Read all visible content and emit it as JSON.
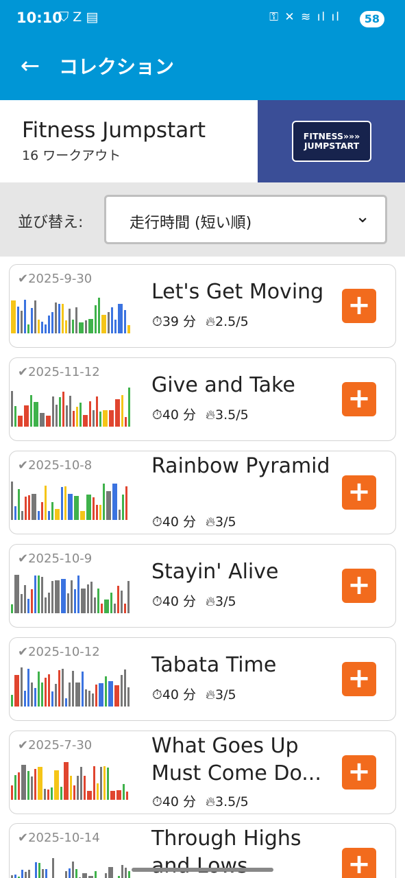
{
  "status": {
    "time": "10:10",
    "battery": "58"
  },
  "appbar": {
    "title": "コレクション"
  },
  "collection": {
    "title": "Fitness Jumpstart",
    "subtitle": "16 ワークアウト",
    "logo_line1": "FITNESS»»»",
    "logo_line2": "JUMPSTART"
  },
  "sort": {
    "label": "並び替え:",
    "value": "走行時間 (短い順)"
  },
  "workouts": [
    {
      "date": "2025-9-30",
      "title": "Let's Get Moving",
      "duration": "39 分",
      "intensity": "2.5/5"
    },
    {
      "date": "2025-11-12",
      "title": "Give and Take",
      "duration": "40 分",
      "intensity": "3.5/5"
    },
    {
      "date": "2025-10-8",
      "title": "Rainbow Pyramid",
      "duration": "40 分",
      "intensity": "3/5"
    },
    {
      "date": "2025-10-9",
      "title": "Stayin' Alive",
      "duration": "40 分",
      "intensity": "3/5"
    },
    {
      "date": "2025-10-12",
      "title": "Tabata Time",
      "duration": "40 分",
      "intensity": "3/5"
    },
    {
      "date": "2025-7-30",
      "title": "What Goes Up Must Come Do...",
      "duration": "40 分",
      "intensity": "3.5/5"
    },
    {
      "date": "2025-10-14",
      "title": "Through Highs and Lows",
      "duration": "",
      "intensity": ""
    }
  ],
  "colors": {
    "header": "#0096d6",
    "add": "#f26b1d",
    "blue": "#3b73e0",
    "green": "#3fb24b",
    "yellow": "#f5c518",
    "red": "#e0452f",
    "gray": "#777777"
  }
}
